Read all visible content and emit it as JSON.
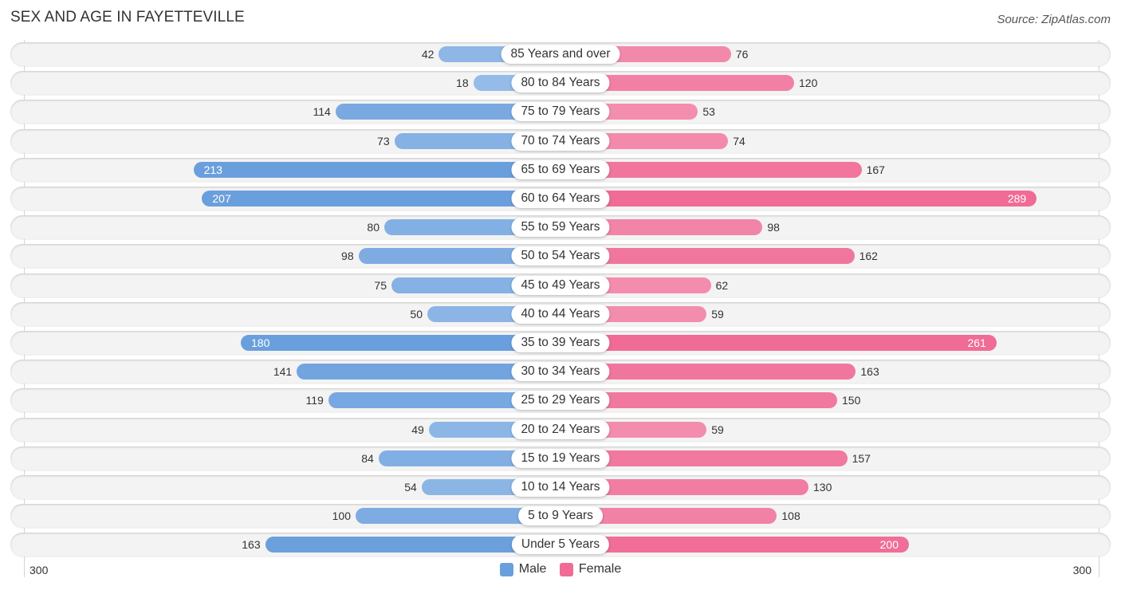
{
  "header": {
    "title": "SEX AND AGE IN FAYETTEVILLE",
    "source": "Source: ZipAtlas.com"
  },
  "chart_data": {
    "type": "bar",
    "orientation": "horizontal-diverging",
    "title": "SEX AND AGE IN FAYETTEVILLE",
    "categories": [
      "85 Years and over",
      "80 to 84 Years",
      "75 to 79 Years",
      "70 to 74 Years",
      "65 to 69 Years",
      "60 to 64 Years",
      "55 to 59 Years",
      "50 to 54 Years",
      "45 to 49 Years",
      "40 to 44 Years",
      "35 to 39 Years",
      "30 to 34 Years",
      "25 to 29 Years",
      "20 to 24 Years",
      "15 to 19 Years",
      "10 to 14 Years",
      "5 to 9 Years",
      "Under 5 Years"
    ],
    "series": [
      {
        "name": "Male",
        "color": "#6a9fdd",
        "values": [
          42,
          18,
          114,
          73,
          213,
          207,
          80,
          98,
          75,
          50,
          180,
          141,
          119,
          49,
          84,
          54,
          100,
          163
        ]
      },
      {
        "name": "Female",
        "color": "#f06b95",
        "values": [
          76,
          120,
          53,
          74,
          167,
          289,
          98,
          162,
          62,
          59,
          261,
          163,
          150,
          59,
          157,
          130,
          108,
          200
        ]
      }
    ],
    "axis": {
      "left_label": "300",
      "right_label": "300",
      "max": 300
    },
    "legend": {
      "position": "bottom-center",
      "items": [
        "Male",
        "Female"
      ]
    },
    "grid": false
  }
}
